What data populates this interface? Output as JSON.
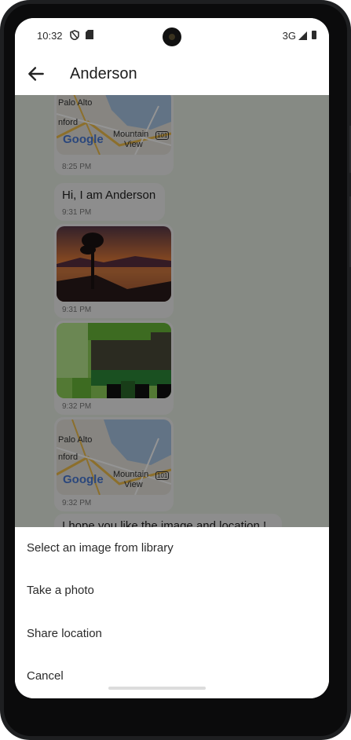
{
  "status_bar": {
    "time": "10:32",
    "network": "3G"
  },
  "app_bar": {
    "title": "Anderson"
  },
  "messages": [
    {
      "type": "location",
      "time": "8:25 PM",
      "map_labels": [
        "Palo Alto",
        "nford",
        "Mountain",
        "View",
        "101",
        "Google"
      ]
    },
    {
      "type": "text",
      "text": "Hi, I am Anderson",
      "time": "9:31 PM"
    },
    {
      "type": "image",
      "time": "9:31 PM"
    },
    {
      "type": "image",
      "time": "9:32 PM"
    },
    {
      "type": "location",
      "time": "9:32 PM",
      "map_labels": [
        "Palo Alto",
        "nford",
        "Mountain",
        "View",
        "101",
        "Google"
      ]
    },
    {
      "type": "text",
      "text": "I hope you like the image and location !"
    }
  ],
  "sheet": {
    "items": [
      "Select an image from library",
      "Take a photo",
      "Share location",
      "Cancel"
    ]
  }
}
